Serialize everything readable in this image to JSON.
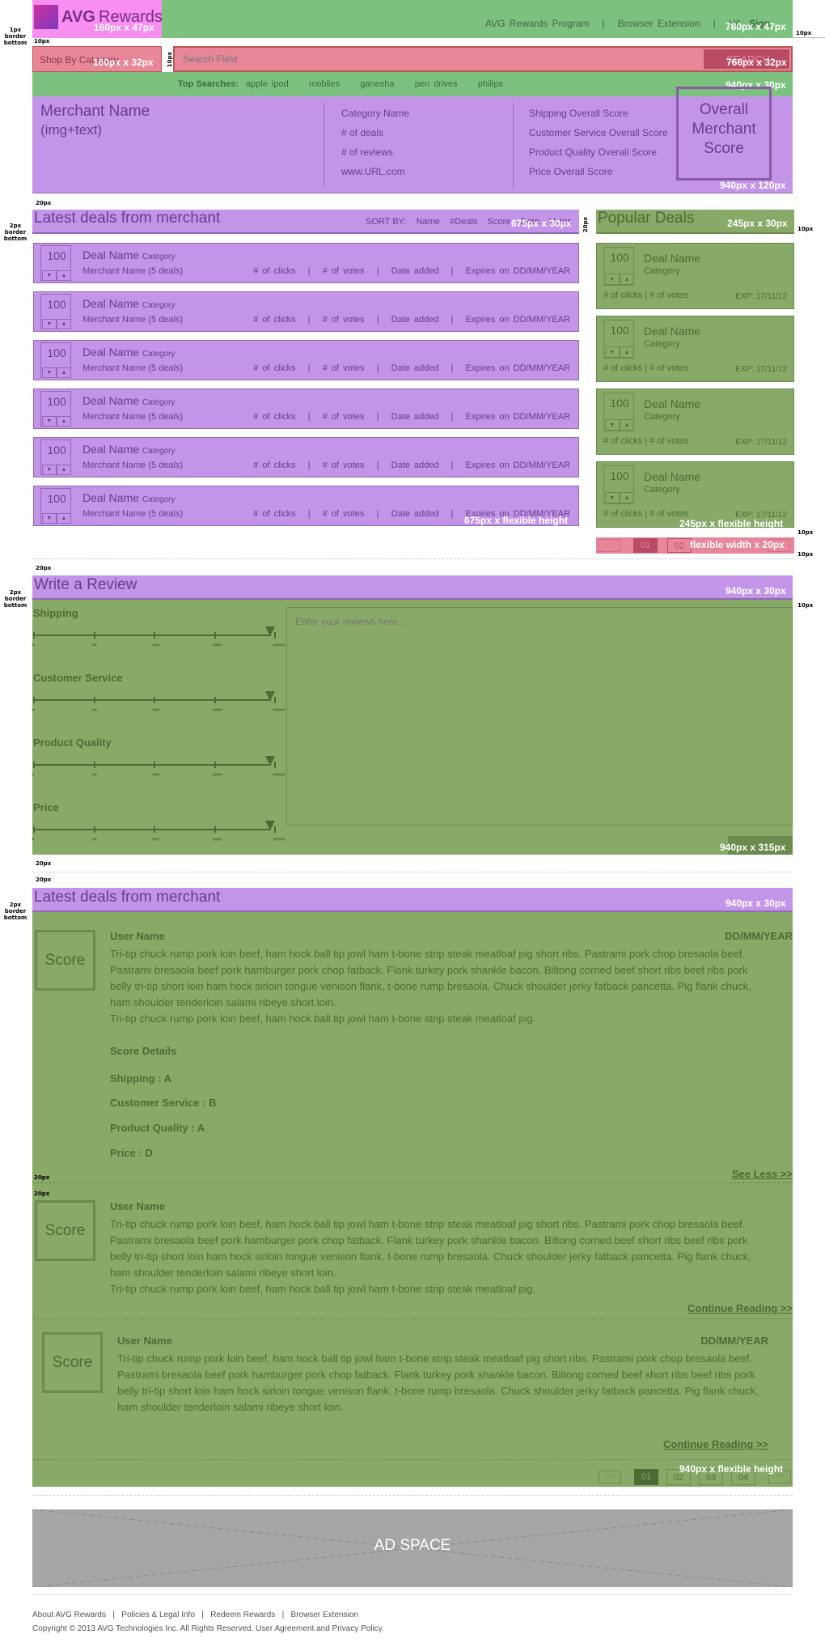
{
  "header": {
    "logo_text": "AVG",
    "logo_sub": "Rewards",
    "logo_dim": "160px x 47px",
    "nav": [
      "AVG Rewards Program",
      "|",
      "Browser Extension",
      "|",
      "Hi!"
    ],
    "signin": "Sign",
    "nav_dim": "780px x 47px"
  },
  "search": {
    "category_label": "Shop By Category",
    "category_dim": "160px x 32px",
    "gap_label": "10px",
    "placeholder": "Search Field",
    "button": "SEARCH",
    "field_dim": "766px x 32px"
  },
  "top_searches": {
    "label": "Top Searches:",
    "items": [
      "apple ipod",
      "mobiles",
      "ganesha",
      "pen drives",
      "philips"
    ],
    "dim": "940px x 30px"
  },
  "merchant": {
    "name": "Merchant Name",
    "name_sub": "(img+text)",
    "col2": [
      "Category Name",
      "# of deals",
      "# of reviews",
      "www.URL.com"
    ],
    "col3": [
      "Shipping Overall Score",
      "Customer Service Overall Score",
      "Product Quality Overall Score",
      "Price Overall Score"
    ],
    "overall": [
      "Overall",
      "Merchant",
      "Score"
    ],
    "dim": "940px x 120px"
  },
  "latest_deals": {
    "title": "Latest deals from merchant",
    "sort_label": "SORT BY:",
    "sort": [
      "Name",
      "#Deals",
      "Score",
      "Date",
      "Votes"
    ],
    "dim": "675px x 30px",
    "list_dim": "675px x flexible height",
    "rows": [
      {
        "score": "100",
        "name": "Deal Name",
        "cat": "Category",
        "merchant": "Merchant Name (5 deals)",
        "meta": "# of clicks   |   # of votes   |   Date added   |   Expires on DD/MM/YEAR"
      },
      {
        "score": "100",
        "name": "Deal Name",
        "cat": "Category",
        "merchant": "Merchant Name (5 deals)",
        "meta": "# of clicks   |   # of votes   |   Date added   |   Expires on DD/MM/YEAR"
      },
      {
        "score": "100",
        "name": "Deal Name",
        "cat": "Category",
        "merchant": "Merchant Name (5 deals)",
        "meta": "# of clicks   |   # of votes   |   Date added   |   Expires on DD/MM/YEAR"
      },
      {
        "score": "100",
        "name": "Deal Name",
        "cat": "Category",
        "merchant": "Merchant Name (5 deals)",
        "meta": "# of clicks   |   # of votes   |   Date added   |   Expires on DD/MM/YEAR"
      },
      {
        "score": "100",
        "name": "Deal Name",
        "cat": "Category",
        "merchant": "Merchant Name (5 deals)",
        "meta": "# of clicks   |   # of votes   |   Date added   |   Expires on DD/MM/YEAR"
      },
      {
        "score": "100",
        "name": "Deal Name",
        "cat": "Category",
        "merchant": "Merchant Name (5 deals)",
        "meta": "# of clicks   |   # of votes   |   Date added   |   Expires on DD/MM/YEAR"
      }
    ]
  },
  "popular": {
    "title": "Popular Deals",
    "dim": "245px x 30px",
    "list_dim": "245px x flexible height",
    "items": [
      {
        "score": "100",
        "name": "Deal Name",
        "cat": "Category",
        "foot": "# of clicks | # of votes",
        "exp": "EXP: 17/11/12"
      },
      {
        "score": "100",
        "name": "Deal Name",
        "cat": "Category",
        "foot": "# of clicks | # of votes",
        "exp": "EXP: 17/11/12"
      },
      {
        "score": "100",
        "name": "Deal Name",
        "cat": "Category",
        "foot": "# of clicks | # of votes",
        "exp": "EXP: 17/11/12"
      },
      {
        "score": "100",
        "name": "Deal Name",
        "cat": "Category",
        "foot": "# of clicks | # of votes",
        "exp": "EXP: 17/11/12"
      }
    ],
    "pager": [
      "<<",
      "01",
      "02",
      ">>"
    ],
    "pager_dim": "flexible width x 20px"
  },
  "annotations": {
    "border_1px": [
      "1px",
      "border",
      "bottom"
    ],
    "border_2px": [
      "2px",
      "border",
      "bottom"
    ],
    "p10": "10px",
    "p20": "20px"
  },
  "write_review": {
    "title": "Write a Review",
    "dim": "940px x 30px",
    "textarea_placeholder": "Enter your reviews here...",
    "panel_dim": "940px x 315px",
    "ratings": [
      "Shipping",
      "Customer Service",
      "Product Quality",
      "Price"
    ],
    "star_labels": [
      "*",
      "**",
      "***",
      "****",
      "*****"
    ]
  },
  "reviews": {
    "title": "Latest deals from merchant",
    "dim": "940px x 30px",
    "panel_dim": "940px x flexible height",
    "lorem": "Tri-tip chuck rump pork loin beef, ham hock ball tip jowl ham t-bone strip steak meatloaf pig short ribs. Pastrami pork chop bresaola beef. Pastrami bresaola beef pork hamburger pork chop fatback. Flank turkey pork shankle bacon. Biltong corned beef short ribs beef ribs pork belly tri-tip short loin ham hock sirloin tongue venison flank, t-bone rump bresaola. Chuck shoulder jerky fatback pancetta. Pig flank chuck, ham shoulder tenderloin salami ribeye short loin.",
    "lorem2": "Tri-tip chuck rump pork loin beef, ham hock ball tip jowl ham t-bone strip steak meatloaf pig.",
    "score": "Score",
    "user": "User Name",
    "date": "DD/MM/YEAR",
    "details_title": "Score Details",
    "details": [
      "Shipping : A",
      "Customer Service : B",
      "Product Quality : A",
      "Price : D"
    ],
    "see_less": "See Less >>",
    "continue": "Continue Reading >>",
    "pager": [
      "<<",
      "01",
      "02",
      "03",
      "04",
      ">>"
    ]
  },
  "ad": {
    "label": "AD SPACE"
  },
  "footer": {
    "links": [
      "About AVG Rewards",
      "|",
      "Policies & Legal Info",
      "|",
      "Redeem Rewards",
      "|",
      "Browser Extension"
    ],
    "copyright": "Copyright © 2013 AVG Technologies Inc. All Rights Reserved. User Agreement and Privacy Policy."
  }
}
